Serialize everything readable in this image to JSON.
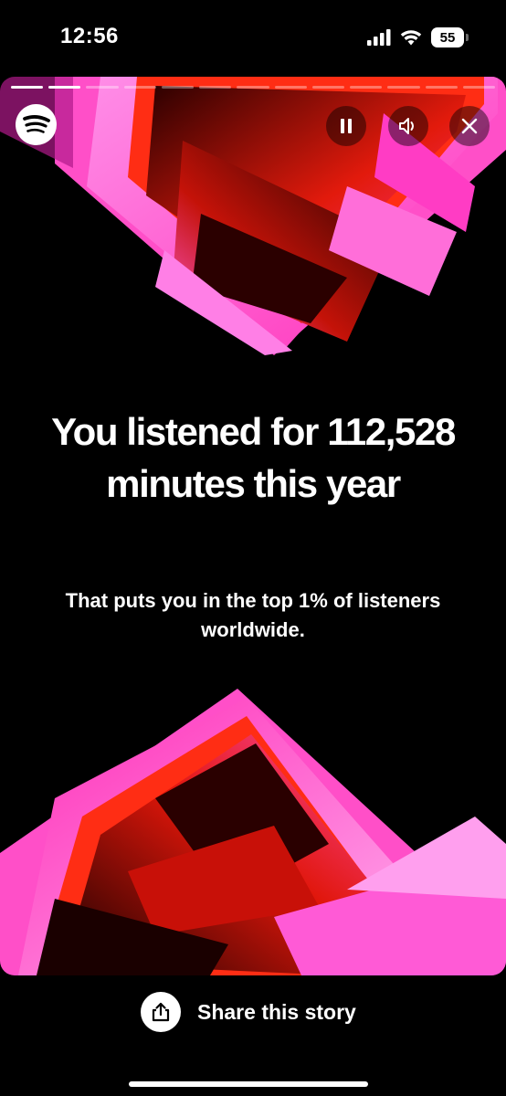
{
  "status_bar": {
    "time": "12:56",
    "battery": "55",
    "icons": [
      "cellular-signal-icon",
      "wifi-icon",
      "battery-icon"
    ]
  },
  "story": {
    "progress": {
      "total_segments": 13,
      "current_segment": 2
    },
    "logo_icon": "spotify-icon",
    "controls": [
      "pause-icon",
      "sound-icon",
      "close-icon"
    ],
    "headline": "You listened for 112,528 minutes this year",
    "subline": "That puts you in the top 1% of listeners worldwide.",
    "accent_colors": {
      "pink": "#ff5ad6",
      "red": "#ff2a14",
      "dark": "#1a0000"
    }
  },
  "share": {
    "label": "Share this story",
    "icon": "share-icon"
  }
}
